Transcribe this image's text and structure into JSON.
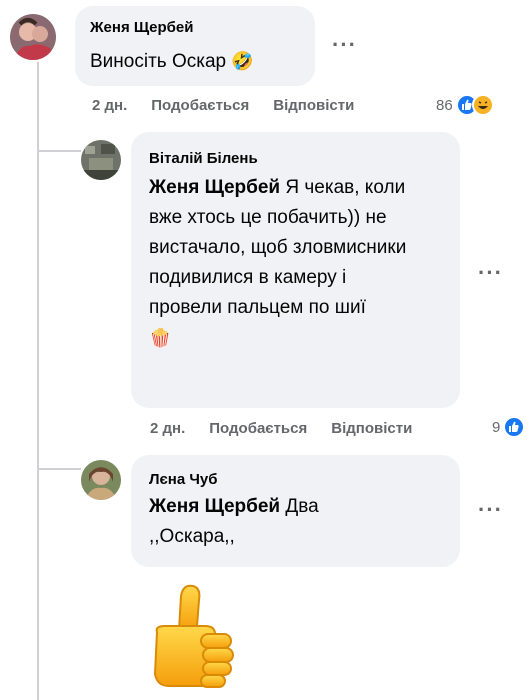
{
  "comments": [
    {
      "author": "Женя Щербей",
      "text": "Виносіть Оскар",
      "emoji": "🤣",
      "time": "2 дн.",
      "like": "Подобається",
      "reply": "Відповісти",
      "reactions_count": "86",
      "reactions": [
        "like-icon",
        "haha-icon"
      ]
    },
    {
      "author": "Віталій Білень",
      "mention": "Женя Щербей",
      "text": " Я чекав, коли вже хтось це побачить)) не вистачало, щоб зловмисники подивилися в камеру і провели пальцем по шиї",
      "emoji": "🍿",
      "time": "2 дн.",
      "like": "Подобається",
      "reply": "Відповісти",
      "reactions_count": "9",
      "reactions": [
        "like-icon"
      ]
    },
    {
      "author": "Лєна Чуб",
      "mention": "Женя Щербей",
      "text": " Два ,,Оскара,,",
      "sticker": "👍"
    }
  ],
  "ui": {
    "more": "···",
    "accent": "#1877f2"
  }
}
